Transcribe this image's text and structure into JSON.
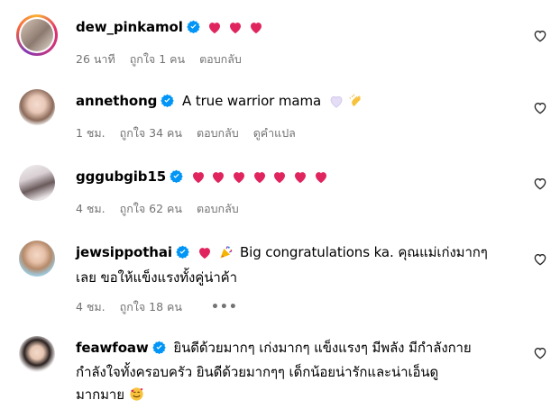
{
  "comments": [
    {
      "username": "dew_pinkamol",
      "text": "",
      "hearts": 3,
      "meta": {
        "time": "26 นาที",
        "likes": "ถูกใจ 1 คน",
        "reply": "ตอบกลับ"
      },
      "avatar": "avatar-ring"
    },
    {
      "username": "annethong",
      "text": "A true warrior mama",
      "hearts": 0,
      "meta": {
        "time": "1 ชม.",
        "likes": "ถูกใจ 34 คน",
        "reply": "ตอบกลับ",
        "translate": "ดูคำแปล"
      },
      "avatar": "avatar-plain"
    },
    {
      "username": "gggubgib15",
      "text": "",
      "hearts": 7,
      "meta": {
        "time": "4 ชม.",
        "likes": "ถูกใจ 62 คน",
        "reply": "ตอบกลับ"
      },
      "avatar": "avatar-plain"
    },
    {
      "username": "jewsippothai",
      "text_line1": "Big congratulations ka. คุณแม่เก่งมากๆ",
      "text_line2": "เลย ขอให้แข็งแรงทั้งคู่น่าค้า",
      "hearts": 1,
      "meta": {
        "time": "4 ชม.",
        "likes": "ถูกใจ 18 คน",
        "more": "•••"
      },
      "avatar": "avatar-plain"
    },
    {
      "username": "feawfoaw",
      "text_line1": "ยินดีด้วยมากๆ เก่งมากๆ แข็งแรงๆ มีพลัง มีกำลังกาย",
      "text_line2": "กำลังใจทั้งครอบครัว ยินดีด้วยมากๆๆ เด็กน้อยน่ารักและน่าเอ็นดู",
      "text_line3": "มากมาย",
      "hearts": 0,
      "avatar": "avatar-plain"
    }
  ],
  "colors": {
    "verified": "#0095f6",
    "heart": "#e0245e",
    "meta": "#737373"
  }
}
